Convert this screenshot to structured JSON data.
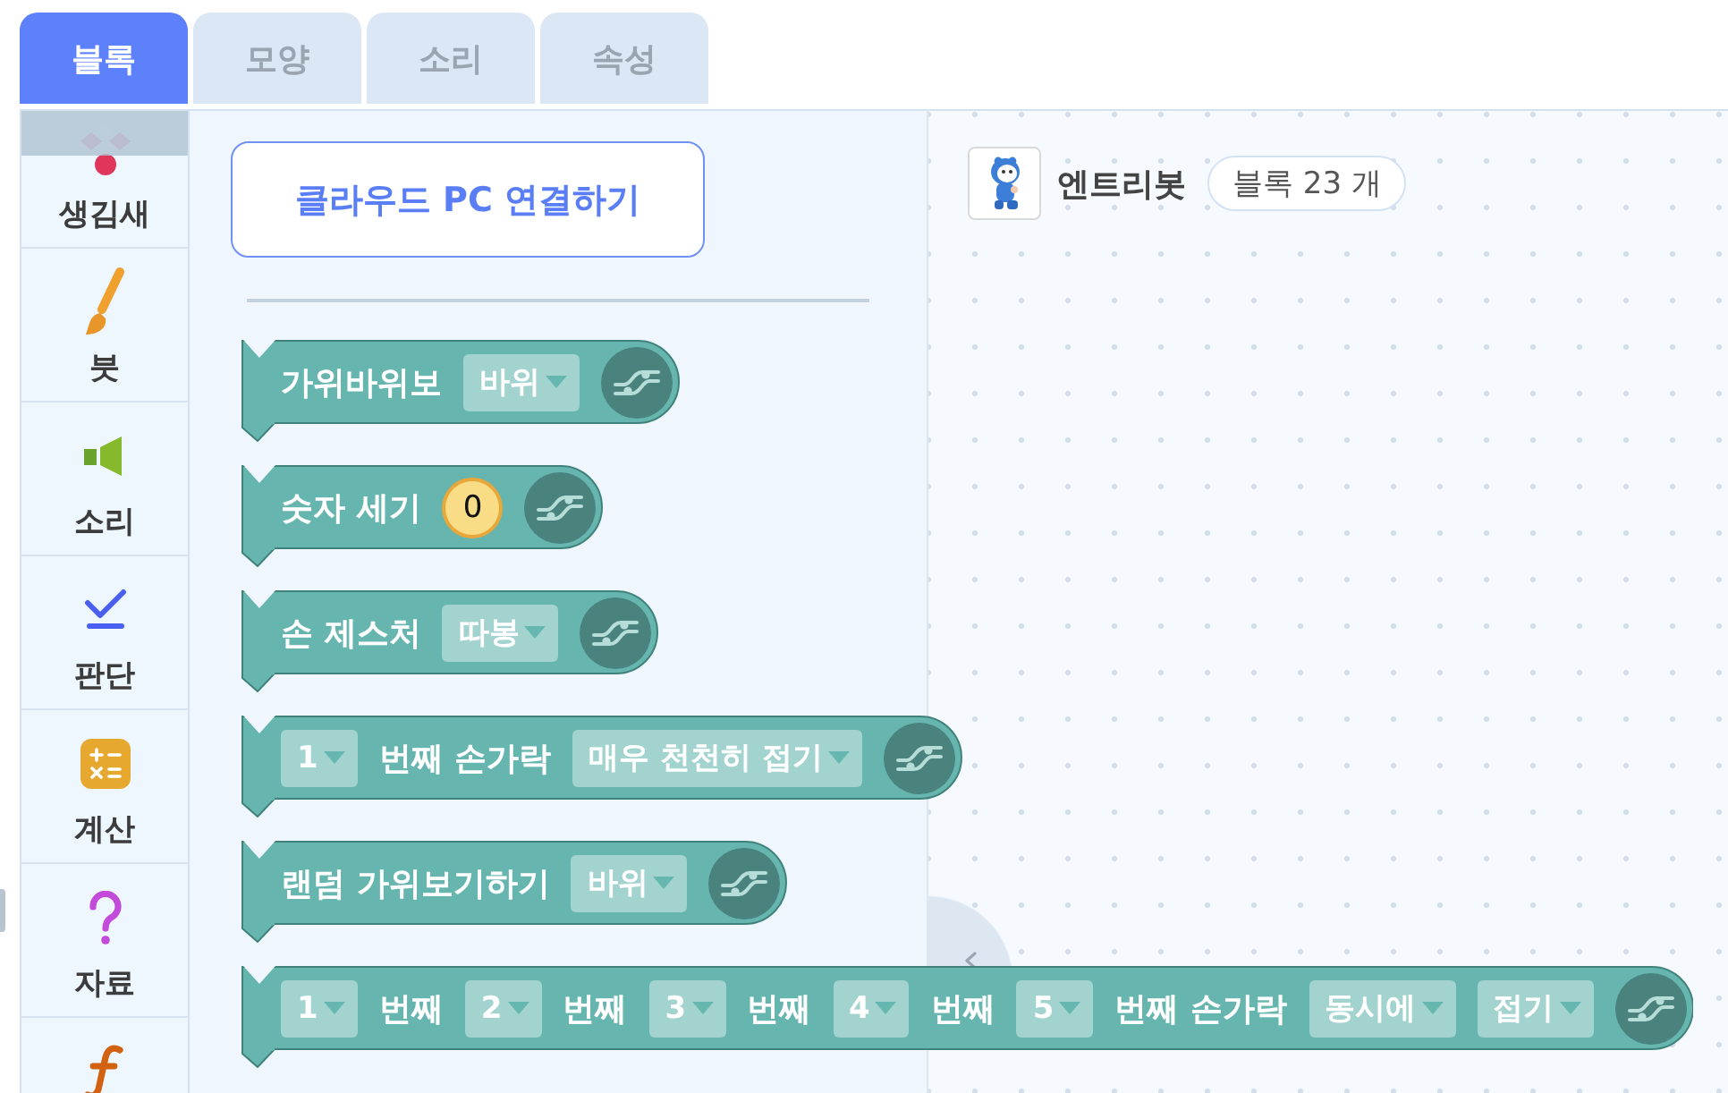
{
  "tabs": [
    {
      "label": "블록",
      "selected": true
    },
    {
      "label": "모양",
      "selected": false
    },
    {
      "label": "소리",
      "selected": false
    },
    {
      "label": "속성",
      "selected": false
    }
  ],
  "categories": [
    {
      "kind": "looks",
      "label": "생김새",
      "selected": false
    },
    {
      "kind": "brush",
      "label": "붓",
      "selected": false
    },
    {
      "kind": "sound",
      "label": "소리",
      "selected": false
    },
    {
      "kind": "judgement",
      "label": "판단",
      "selected": false
    },
    {
      "kind": "calc",
      "label": "계산",
      "selected": false
    },
    {
      "kind": "data",
      "label": "자료",
      "selected": false
    },
    {
      "kind": "function",
      "selected": false
    }
  ],
  "palette": {
    "cloud_button": "클라우드 PC 연결하기",
    "blocks": [
      {
        "parts": [
          {
            "kind": "text",
            "text": "가위바위보"
          },
          {
            "kind": "dropdown",
            "text": "바위"
          }
        ]
      },
      {
        "parts": [
          {
            "kind": "text",
            "text": "숫자 세기"
          },
          {
            "kind": "number",
            "text": "0"
          }
        ]
      },
      {
        "parts": [
          {
            "kind": "text",
            "text": "손 제스처"
          },
          {
            "kind": "dropdown",
            "text": "따봉"
          }
        ]
      },
      {
        "parts": [
          {
            "kind": "dropdown",
            "text": "1"
          },
          {
            "kind": "text",
            "text": "번째 손가락"
          },
          {
            "kind": "dropdown",
            "text": "매우 천천히 접기"
          }
        ]
      },
      {
        "parts": [
          {
            "kind": "text",
            "text": "랜덤 가위보기하기"
          },
          {
            "kind": "dropdown",
            "text": "바위"
          }
        ]
      },
      {
        "parts": [
          {
            "kind": "dropdown",
            "text": "1"
          },
          {
            "kind": "text",
            "text": "번째"
          },
          {
            "kind": "dropdown",
            "text": "2"
          },
          {
            "kind": "text",
            "text": "번째"
          },
          {
            "kind": "dropdown",
            "text": "3"
          },
          {
            "kind": "text",
            "text": "번째"
          },
          {
            "kind": "dropdown",
            "text": "4"
          },
          {
            "kind": "text",
            "text": "번째"
          },
          {
            "kind": "dropdown",
            "text": "5"
          },
          {
            "kind": "text",
            "text": "번째 손가락"
          },
          {
            "kind": "dropdown",
            "text": "동시에"
          },
          {
            "kind": "dropdown",
            "text": "접기"
          }
        ]
      }
    ]
  },
  "workspace": {
    "object_name": "엔트리봇",
    "block_count": "블록 23 개"
  }
}
